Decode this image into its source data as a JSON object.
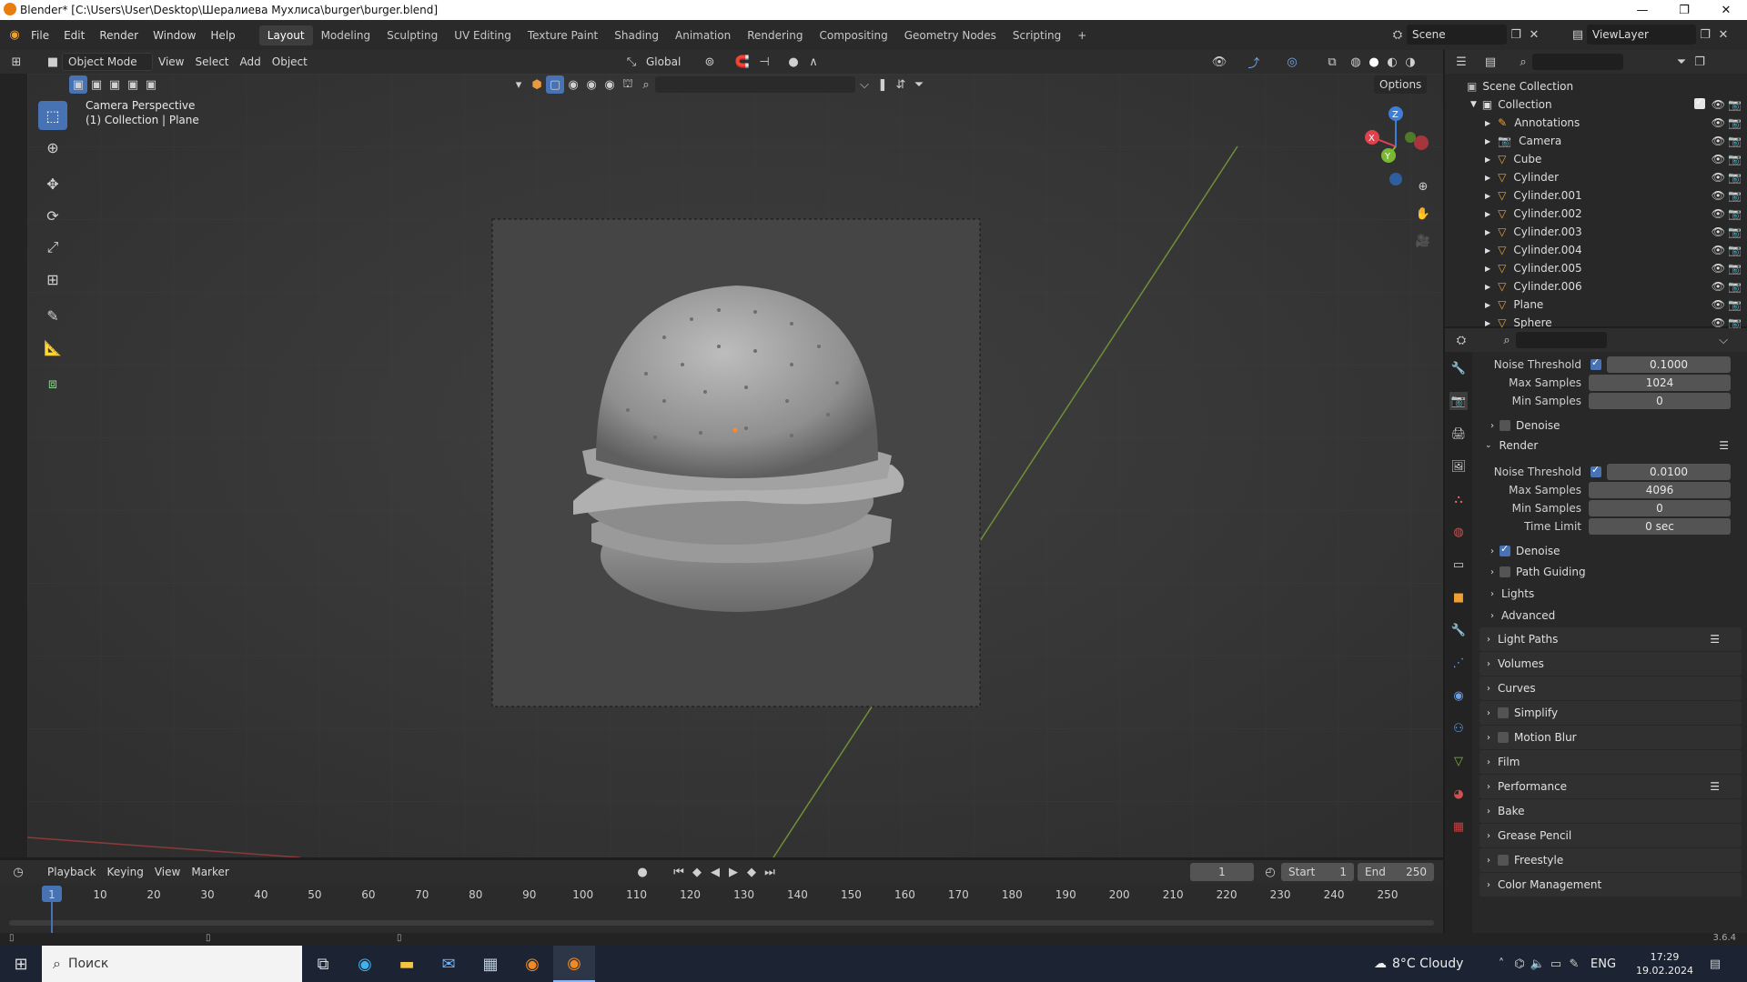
{
  "window": {
    "title": "Blender* [C:\\Users\\User\\Desktop\\Шералиева Мухлиса\\burger\\burger.blend]",
    "controls": [
      "—",
      "❐",
      "✕"
    ]
  },
  "menubar": {
    "menus": [
      "File",
      "Edit",
      "Render",
      "Window",
      "Help"
    ],
    "workspaces": [
      "Layout",
      "Modeling",
      "Sculpting",
      "UV Editing",
      "Texture Paint",
      "Shading",
      "Animation",
      "Rendering",
      "Compositing",
      "Geometry Nodes",
      "Scripting"
    ],
    "active_workspace": "Layout",
    "add_tab": "+",
    "scene": "Scene",
    "view_layer": "ViewLayer"
  },
  "viewport_header": {
    "mode": "Object Mode",
    "menus": [
      "View",
      "Select",
      "Add",
      "Object"
    ],
    "orientation": "Global",
    "options": "Options"
  },
  "viewport": {
    "camera_label": "Camera Perspective",
    "collection_label": "(1) Collection | Plane",
    "gizmo_axes": [
      "Z",
      "X",
      "Y"
    ]
  },
  "outliner": {
    "root": "Scene Collection",
    "collection": "Collection",
    "items": [
      {
        "name": "Annotations",
        "icon": "annotation-icon"
      },
      {
        "name": "Camera",
        "icon": "camera-icon"
      },
      {
        "name": "Cube",
        "icon": "mesh-icon"
      },
      {
        "name": "Cylinder",
        "icon": "mesh-icon"
      },
      {
        "name": "Cylinder.001",
        "icon": "mesh-icon"
      },
      {
        "name": "Cylinder.002",
        "icon": "mesh-icon"
      },
      {
        "name": "Cylinder.003",
        "icon": "mesh-icon"
      },
      {
        "name": "Cylinder.004",
        "icon": "mesh-icon"
      },
      {
        "name": "Cylinder.005",
        "icon": "mesh-icon"
      },
      {
        "name": "Cylinder.006",
        "icon": "mesh-icon"
      },
      {
        "name": "Plane",
        "icon": "mesh-icon"
      },
      {
        "name": "Sphere",
        "icon": "mesh-icon"
      }
    ]
  },
  "properties": {
    "viewport_noise_threshold_label": "Noise Threshold",
    "viewport_noise_threshold": "0.1000",
    "viewport_max_samples_label": "Max Samples",
    "viewport_max_samples": "1024",
    "viewport_min_samples_label": "Min Samples",
    "viewport_min_samples": "0",
    "viewport_denoise": "Denoise",
    "render_header": "Render",
    "render_noise_threshold_label": "Noise Threshold",
    "render_noise_threshold": "0.0100",
    "render_max_samples_label": "Max Samples",
    "render_max_samples": "4096",
    "render_min_samples_label": "Min Samples",
    "render_min_samples": "0",
    "time_limit_label": "Time Limit",
    "time_limit": "0 sec",
    "render_denoise": "Denoise",
    "path_guiding": "Path Guiding",
    "lights": "Lights",
    "advanced": "Advanced",
    "panels": [
      "Light Paths",
      "Volumes",
      "Curves",
      "Simplify",
      "Motion Blur",
      "Film",
      "Performance",
      "Bake",
      "Grease Pencil",
      "Freestyle",
      "Color Management"
    ]
  },
  "timeline": {
    "menus": [
      "Playback",
      "Keying",
      "View",
      "Marker"
    ],
    "current_frame": "1",
    "start_label": "Start",
    "start": "1",
    "end_label": "End",
    "end": "250",
    "ruler": [
      "1",
      "10",
      "20",
      "30",
      "40",
      "50",
      "60",
      "70",
      "80",
      "90",
      "100",
      "110",
      "120",
      "130",
      "140",
      "150",
      "160",
      "170",
      "180",
      "190",
      "200",
      "210",
      "220",
      "230",
      "240",
      "250"
    ]
  },
  "statusbar": {
    "version": "3.6.4"
  },
  "taskbar": {
    "search_placeholder": "Поиск",
    "weather": "8°C  Cloudy",
    "language": "ENG",
    "time": "17:29",
    "date": "19.02.2024"
  },
  "colors": {
    "accent": "#4772b3",
    "viewport_bg": "#3a3a3a",
    "panel_bg": "#282828",
    "x_axis": "#e0424c",
    "y_axis": "#7ab833",
    "z_axis": "#3d7fd8"
  }
}
